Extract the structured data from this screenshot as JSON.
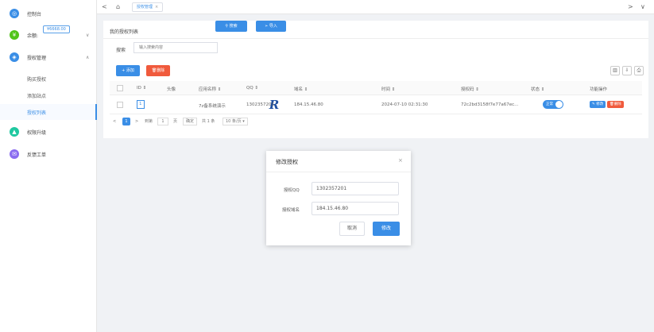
{
  "sidebar": {
    "console": "控制台",
    "balance_label": "余额:",
    "balance_value": "¥6668.00",
    "auth_manage": "授权管理",
    "sub_items": [
      "购买授权",
      "添加站点",
      "授权列表"
    ],
    "upgrade": "权限升级",
    "feedback": "反馈工单"
  },
  "topbar": {
    "back": "<",
    "home_icon": "home-icon",
    "tab_label": "授权管理",
    "tab_close": "×",
    "forward": ">",
    "dropdown": "∨"
  },
  "card": {
    "title": "我的授权列表",
    "search_label": "搜索",
    "search_placeholder": "输入搜索内容",
    "search_button": "搜索",
    "import_button": "导入",
    "add_button": "+ 添加",
    "delete_button": "删除",
    "tool_icons": [
      "columns-icon",
      "export-icon",
      "print-icon"
    ]
  },
  "table": {
    "headers": [
      "ID ⇕",
      "头像",
      "应用名称 ⇕",
      "QQ ⇕",
      "域名 ⇕",
      "时间 ⇕",
      "授权码 ⇕",
      "状态 ⇕",
      "功能操作"
    ],
    "row": {
      "id": "1",
      "logo_text": "R",
      "app_name": "7z备系统演示",
      "qq": "1302357201",
      "domain": "184.15.46.80",
      "time": "2024-07-10 02:31:30",
      "code": "72c2bd3158f7e77a67ec...",
      "status": "正常",
      "edit": "✎ 修改",
      "delete": "删除"
    }
  },
  "pager": {
    "prev": "<",
    "page": "1",
    "next": ">",
    "goto": "到第",
    "page_input": "1",
    "page_unit": "页",
    "confirm": "确定",
    "total": "共 1 条",
    "per_page": "10 条/页 ▾"
  },
  "modal": {
    "title": "修改授权",
    "close": "×",
    "qq_label": "授权QQ",
    "qq_value": "1302357201",
    "domain_label": "授权域名",
    "domain_value": "184.15.46.80",
    "cancel": "取消",
    "submit": "修改"
  },
  "colors": {
    "accent": "#3a8ee6",
    "danger": "#f05a3c",
    "console_icon": "#3a8ee6",
    "balance_icon": "#52c41a",
    "auth_icon": "#3a8ee6",
    "upgrade_icon": "#1fc8a0",
    "feedback_icon": "#8a6cf0"
  }
}
